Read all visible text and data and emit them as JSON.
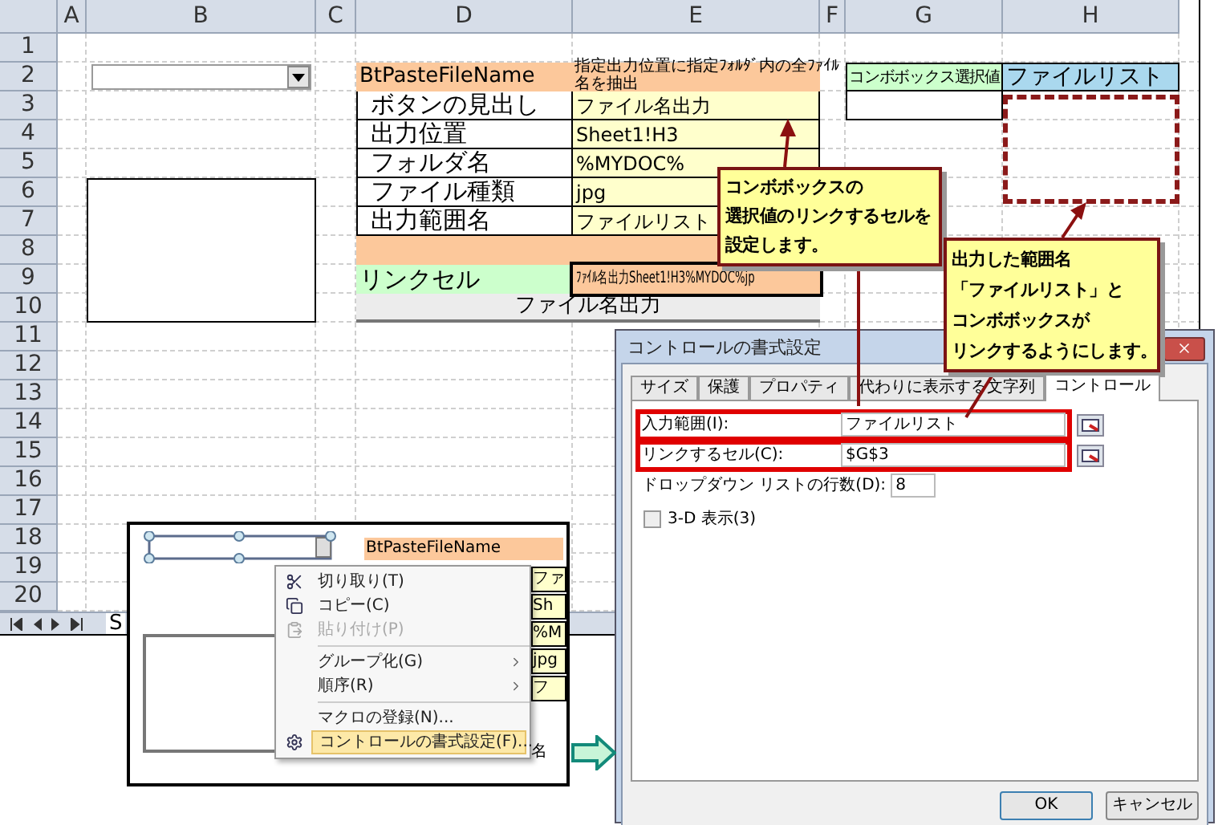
{
  "sheet": {
    "column_headers": [
      "A",
      "B",
      "C",
      "D",
      "E",
      "F",
      "G",
      "H"
    ],
    "row_headers": [
      "1",
      "2",
      "3",
      "4",
      "5",
      "6",
      "7",
      "8",
      "9",
      "10",
      "11",
      "12",
      "13",
      "14",
      "15",
      "16",
      "17",
      "18",
      "19",
      "20"
    ],
    "settings": {
      "title": "BtPasteFileName",
      "description": "指定出力位置に指定ﾌｫﾙﾀﾞ内の全ﾌｧｲﾙ名を抽出",
      "rows": [
        {
          "label": "ボタンの見出し",
          "value": "ファイル名出力"
        },
        {
          "label": "出力位置",
          "value": "Sheet1!H3"
        },
        {
          "label": "フォルダ名",
          "value": "%MYDOC%"
        },
        {
          "label": "ファイル種類",
          "value": "jpg"
        },
        {
          "label": "出力範囲名",
          "value": "ファイルリスト"
        }
      ],
      "link_label": "リンクセル",
      "link_value": "ﾌｧｲﾙ名出力Sheet1!H3%MYDOC%jp",
      "button": "ファイル名出力"
    },
    "output_headers": [
      "コンボボックス選択値",
      "ファイルリスト"
    ],
    "sheet_tab": "S"
  },
  "callouts": [
    {
      "lines": [
        "コンボボックスの",
        "選択値のリンクするセルを",
        "設定します。"
      ]
    },
    {
      "lines": [
        "出力した範囲名",
        "「ファイルリスト」と",
        "コンボボックスが",
        "リンクするようにします。"
      ]
    }
  ],
  "inset": {
    "title_fragment": "BtPasteFileName",
    "cell_fragments": [
      "ファ",
      "Sh",
      "%M",
      "jpg",
      "フ",
      "名"
    ],
    "menu": [
      {
        "kind": "item",
        "label": "切り取り(T)",
        "disabled": false,
        "highlighted": false,
        "submenu": false
      },
      {
        "kind": "item",
        "label": "コピー(C)",
        "disabled": false,
        "highlighted": false,
        "submenu": false
      },
      {
        "kind": "item",
        "label": "貼り付け(P)",
        "disabled": true,
        "highlighted": false,
        "submenu": false
      },
      {
        "kind": "separator"
      },
      {
        "kind": "item",
        "label": "グループ化(G)",
        "disabled": false,
        "highlighted": false,
        "submenu": true
      },
      {
        "kind": "item",
        "label": "順序(R)",
        "disabled": false,
        "highlighted": false,
        "submenu": true
      },
      {
        "kind": "separator"
      },
      {
        "kind": "item",
        "label": "マクロの登録(N)...",
        "disabled": false,
        "highlighted": false,
        "submenu": false
      },
      {
        "kind": "item",
        "label": "コントロールの書式設定(F)...",
        "disabled": false,
        "highlighted": true,
        "submenu": false
      }
    ]
  },
  "dialog": {
    "title": "コントロールの書式設定",
    "tabs": [
      {
        "label": "サイズ",
        "selected": false
      },
      {
        "label": "保護",
        "selected": false
      },
      {
        "label": "プロパティ",
        "selected": false
      },
      {
        "label": "代わりに表示する文字列",
        "selected": false
      },
      {
        "label": "コントロール",
        "selected": true
      }
    ],
    "fields": [
      {
        "kind": "range",
        "label": "入力範囲(I):",
        "value": "ファイルリスト",
        "highlighted": true
      },
      {
        "kind": "range",
        "label": "リンクするセル(C):",
        "value": "$G$3",
        "highlighted": true
      },
      {
        "kind": "number",
        "label": "ドロップダウン リストの行数(D):",
        "value": "8",
        "highlighted": false
      }
    ],
    "checkbox": {
      "label": "3-D 表示(3)",
      "checked": false
    },
    "buttons": [
      "OK",
      "キャンセル"
    ]
  }
}
